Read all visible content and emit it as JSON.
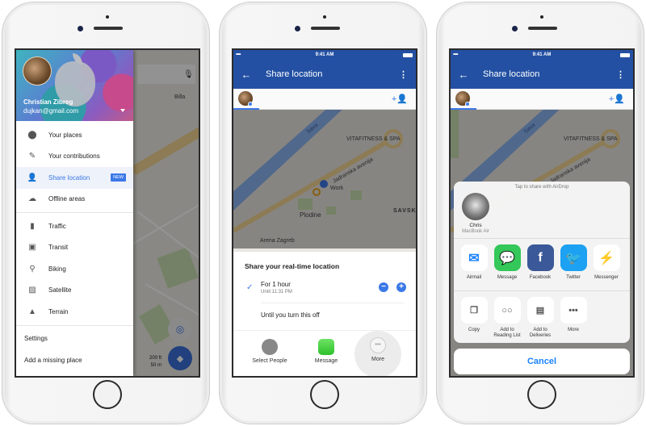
{
  "status_bar": {
    "time": "9:41 AM",
    "signal": "•••••"
  },
  "phone1": {
    "drawer": {
      "user_name": "Christian Zibreg",
      "user_email": "dujkan@gmail.com",
      "items_top": [
        {
          "label": "Your places",
          "icon": "pin-icon",
          "glyph": "⬤"
        },
        {
          "label": "Your contributions",
          "icon": "contributions-icon",
          "glyph": "✎"
        },
        {
          "label": "Share location",
          "icon": "share-location-icon",
          "glyph": "👤",
          "badge": "NEW",
          "active": true
        },
        {
          "label": "Offline areas",
          "icon": "cloud-off-icon",
          "glyph": "☁"
        }
      ],
      "items_layers": [
        {
          "label": "Traffic",
          "icon": "traffic-icon",
          "glyph": "▮"
        },
        {
          "label": "Transit",
          "icon": "transit-icon",
          "glyph": "▣"
        },
        {
          "label": "Biking",
          "icon": "bike-icon",
          "glyph": "⚲"
        },
        {
          "label": "Satellite",
          "icon": "satellite-icon",
          "glyph": "▨"
        },
        {
          "label": "Terrain",
          "icon": "terrain-icon",
          "glyph": "▲"
        }
      ],
      "items_bottom": [
        {
          "label": "Settings"
        },
        {
          "label": "Add a missing place"
        }
      ]
    },
    "map": {
      "poi": "Billa",
      "scale_ft": "200 ft",
      "scale_m": "50 m",
      "mic": "🎙",
      "locate": "◎",
      "directions": "◆"
    }
  },
  "phone2": {
    "title": "Share location",
    "back": "←",
    "menu": "⋮",
    "add_person": "+👤",
    "map_labels": {
      "poi_gym": "VITAFITNESS & SPA",
      "road": "Jadranska avenija",
      "work": "Work",
      "store": "Plodine",
      "district": "SAVSK",
      "arena": "Arena Zagreb",
      "river": "Sava"
    },
    "sheet": {
      "title": "Share your real-time location",
      "option1_label": "For 1 hour",
      "option1_sub": "Until 11:31 PM",
      "option2_label": "Until you turn this off",
      "check": "✓",
      "minus": "−",
      "plus": "+",
      "actions": [
        {
          "label": "Select People"
        },
        {
          "label": "Message"
        },
        {
          "label": "More",
          "glyph": "•••"
        }
      ]
    }
  },
  "phone3": {
    "title": "Share location",
    "back": "←",
    "menu": "⋮",
    "add_person": "+👤",
    "map_labels": {
      "poi_gym": "VITAFITNESS & SPA",
      "road": "Jadranska avenija",
      "river": "Sava"
    },
    "share_sheet": {
      "airdrop_title": "Tap to share with AirDrop",
      "airdrop_contact": "Chris",
      "airdrop_device": "MacBook Air",
      "apps": [
        {
          "label": "Airmail",
          "color": "#ffffff",
          "glyph": "✉"
        },
        {
          "label": "Message",
          "color": "#34c759",
          "glyph": "💬"
        },
        {
          "label": "Facebook",
          "color": "#3b5998",
          "glyph": "f"
        },
        {
          "label": "Twitter",
          "color": "#1da1f2",
          "glyph": "🐦"
        },
        {
          "label": "Messenger",
          "color": "#ffffff",
          "glyph": "⚡"
        }
      ],
      "actions": [
        {
          "label": "Copy",
          "glyph": "❐"
        },
        {
          "label": "Add to Reading List",
          "glyph": "○○"
        },
        {
          "label": "Add to Deliveries",
          "glyph": "▤"
        },
        {
          "label": "More",
          "glyph": "•••"
        }
      ],
      "cancel": "Cancel"
    }
  },
  "colors": {
    "brand_blue": "#2350a3",
    "accent": "#3b78e7",
    "ios_blue": "#1a82fb"
  }
}
